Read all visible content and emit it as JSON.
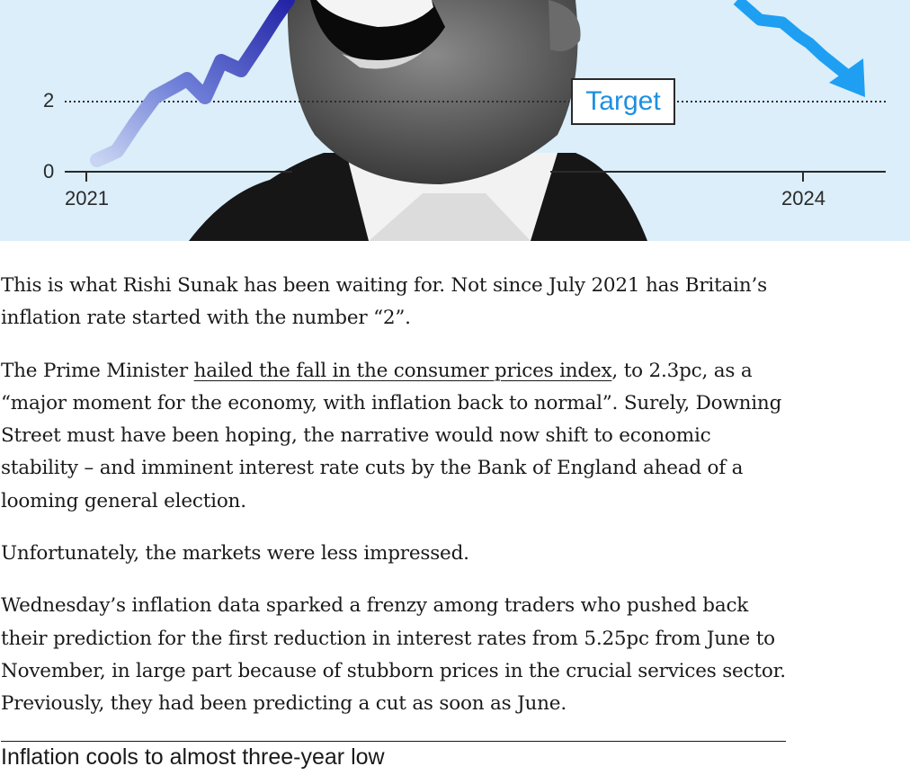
{
  "hero_chart": {
    "y_ticks": [
      "0",
      "2"
    ],
    "x_ticks": [
      "2021",
      "2024"
    ],
    "target_label": "Target",
    "colors": {
      "background": "#dbeef9",
      "rising_line": "#2f2fb0",
      "falling_line": "#1e9ff2",
      "target_text": "#1e8fe0"
    }
  },
  "article": {
    "p1": "This is what Rishi Sunak has been waiting for. Not since July 2021 has Britain’s inflation rate started with the number “2”.",
    "p2_before": "The Prime Minister ",
    "p2_link": "hailed the fall in the consumer prices index",
    "p2_after": ", to 2.3pc, as a “major moment for the economy, with inflation back to normal”. Surely, Downing Street must have been hoping, the narrative would now shift to economic stability – and imminent interest rate cuts by the Bank of England ahead of a looming general election.",
    "p3": "Unfortunately, the markets were less impressed.",
    "p4": "Wednesday’s inflation data sparked a frenzy among traders who pushed back their prediction for the first reduction in interest rates from 5.25pc from June to November, in large part because of stubborn prices in the crucial services sector. Previously, they had been predicting a cut as soon as June."
  },
  "next_chart": {
    "heading": "Inflation cools to almost three-year low"
  }
}
